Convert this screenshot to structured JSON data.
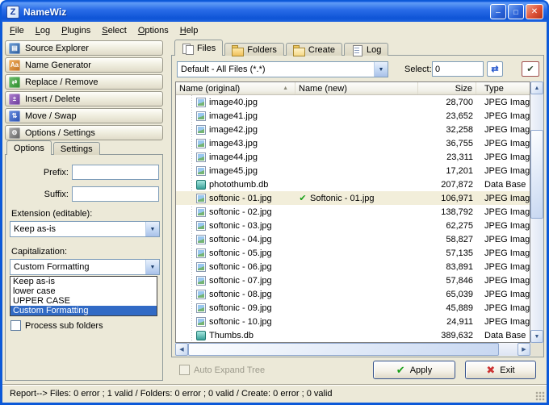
{
  "window": {
    "title": "NameWiz",
    "icon_glyph": "Z",
    "controls": {
      "minimize": "─",
      "maximize": "□",
      "close": "✕"
    }
  },
  "colors": {
    "titlebar_blue": "#0C59D8",
    "panel_tan": "#ECE9D8",
    "selection_blue": "#316AC5",
    "valid_green": "#18A018",
    "exit_red": "#CC3333"
  },
  "menubar": {
    "items": [
      {
        "label": "File",
        "data_name": "menu-item-file"
      },
      {
        "label": "Log",
        "data_name": "menu-item-log"
      },
      {
        "label": "Plugins",
        "data_name": "menu-item-plugins"
      },
      {
        "label": "Select",
        "data_name": "menu-item-select"
      },
      {
        "label": "Options",
        "data_name": "menu-item-options"
      },
      {
        "label": "Help",
        "data_name": "menu-item-help"
      }
    ]
  },
  "sidebar": {
    "buttons": [
      {
        "label": "Source Explorer",
        "glyph": "▤",
        "icon": "source-explorer-icon",
        "data_name": "sidebar-button-source-explorer"
      },
      {
        "label": "Name Generator",
        "glyph": "Aa",
        "icon": "name-generator-icon",
        "data_name": "sidebar-button-name-generator"
      },
      {
        "label": "Replace / Remove",
        "glyph": "⇄",
        "icon": "replace-remove-icon",
        "data_name": "sidebar-button-replace-remove"
      },
      {
        "label": "Insert / Delete",
        "glyph": "±",
        "icon": "insert-delete-icon",
        "data_name": "sidebar-button-insert-delete"
      },
      {
        "label": "Move / Swap",
        "glyph": "⇅",
        "icon": "move-swap-icon",
        "data_name": "sidebar-button-move-swap"
      },
      {
        "label": "Options / Settings",
        "glyph": "⚙",
        "icon": "options-settings-icon",
        "data_name": "sidebar-button-options-settings"
      }
    ],
    "tabs": [
      {
        "label": "Options",
        "active": true,
        "data_name": "tab-options"
      },
      {
        "label": "Settings",
        "active": false,
        "data_name": "tab-settings"
      }
    ],
    "options": {
      "prefix_label": "Prefix:",
      "prefix_value": "",
      "suffix_label": "Suffix:",
      "suffix_value": "",
      "extension_label": "Extension (editable):",
      "extension_value": "Keep as-is",
      "capitalization_label": "Capitalization:",
      "capitalization_value": "Custom Formatting",
      "dropdown": {
        "options": [
          {
            "label": "Keep as-is",
            "selected": false
          },
          {
            "label": "lower case",
            "selected": false
          },
          {
            "label": "UPPER CASE",
            "selected": false
          },
          {
            "label": "Custom Formatting",
            "selected": true
          }
        ]
      },
      "process_sub_folders_label": "Process sub folders"
    }
  },
  "main": {
    "tabs": [
      {
        "label": "Files",
        "active": true,
        "icon": "files-tab-icon",
        "data_name": "tab-files"
      },
      {
        "label": "Folders",
        "active": false,
        "icon": "folders-tab-icon",
        "data_name": "tab-folders"
      },
      {
        "label": "Create",
        "active": false,
        "icon": "create-tab-icon",
        "data_name": "tab-create"
      },
      {
        "label": "Log",
        "active": false,
        "icon": "log-tab-icon",
        "data_name": "tab-log"
      }
    ],
    "filter_value": "Default - All Files (*.*)",
    "select": {
      "label": "Select:",
      "value": "0"
    },
    "table": {
      "columns": {
        "original": "Name (original)",
        "sort_glyph": "▲",
        "new": "Name (new)",
        "size": "Size",
        "type": "Type"
      },
      "rows": [
        {
          "name": "image40.jpg",
          "new_name": "",
          "size": "28,700",
          "type": "JPEG Imag",
          "icon": "jpeg-file-icon",
          "selected": false
        },
        {
          "name": "image41.jpg",
          "new_name": "",
          "size": "23,652",
          "type": "JPEG Imag",
          "icon": "jpeg-file-icon",
          "selected": false
        },
        {
          "name": "image42.jpg",
          "new_name": "",
          "size": "32,258",
          "type": "JPEG Imag",
          "icon": "jpeg-file-icon",
          "selected": false
        },
        {
          "name": "image43.jpg",
          "new_name": "",
          "size": "36,755",
          "type": "JPEG Imag",
          "icon": "jpeg-file-icon",
          "selected": false
        },
        {
          "name": "image44.jpg",
          "new_name": "",
          "size": "23,311",
          "type": "JPEG Imag",
          "icon": "jpeg-file-icon",
          "selected": false
        },
        {
          "name": "image45.jpg",
          "new_name": "",
          "size": "17,201",
          "type": "JPEG Imag",
          "icon": "jpeg-file-icon",
          "selected": false
        },
        {
          "name": "photothumb.db",
          "new_name": "",
          "size": "207,872",
          "type": "Data Base",
          "icon": "db-file-icon",
          "selected": false
        },
        {
          "name": "softonic - 01.jpg",
          "new_name": "Softonic - 01.jpg",
          "size": "106,971",
          "type": "JPEG Imag",
          "icon": "jpeg-file-icon",
          "selected": true
        },
        {
          "name": "softonic - 02.jpg",
          "new_name": "",
          "size": "138,792",
          "type": "JPEG Imag",
          "icon": "jpeg-file-icon",
          "selected": false
        },
        {
          "name": "softonic - 03.jpg",
          "new_name": "",
          "size": "62,275",
          "type": "JPEG Imag",
          "icon": "jpeg-file-icon",
          "selected": false
        },
        {
          "name": "softonic - 04.jpg",
          "new_name": "",
          "size": "58,827",
          "type": "JPEG Imag",
          "icon": "jpeg-file-icon",
          "selected": false
        },
        {
          "name": "softonic - 05.jpg",
          "new_name": "",
          "size": "57,135",
          "type": "JPEG Imag",
          "icon": "jpeg-file-icon",
          "selected": false
        },
        {
          "name": "softonic - 06.jpg",
          "new_name": "",
          "size": "83,891",
          "type": "JPEG Imag",
          "icon": "jpeg-file-icon",
          "selected": false
        },
        {
          "name": "softonic - 07.jpg",
          "new_name": "",
          "size": "57,846",
          "type": "JPEG Imag",
          "icon": "jpeg-file-icon",
          "selected": false
        },
        {
          "name": "softonic - 08.jpg",
          "new_name": "",
          "size": "65,039",
          "type": "JPEG Imag",
          "icon": "jpeg-file-icon",
          "selected": false
        },
        {
          "name": "softonic - 09.jpg",
          "new_name": "",
          "size": "45,889",
          "type": "JPEG Imag",
          "icon": "jpeg-file-icon",
          "selected": false
        },
        {
          "name": "softonic - 10.jpg",
          "new_name": "",
          "size": "24,911",
          "type": "JPEG Imag",
          "icon": "jpeg-file-icon",
          "selected": false
        },
        {
          "name": "Thumbs.db",
          "new_name": "",
          "size": "389,632",
          "type": "Data Base",
          "icon": "db-file-icon",
          "selected": false
        }
      ]
    },
    "auto_expand_label": "Auto Expand Tree",
    "apply_label": "Apply",
    "exit_label": "Exit"
  },
  "statusbar": {
    "text": "Report--> Files: 0 error ; 1 valid  /  Folders: 0 error ; 0 valid  /  Create: 0 error ; 0 valid"
  }
}
